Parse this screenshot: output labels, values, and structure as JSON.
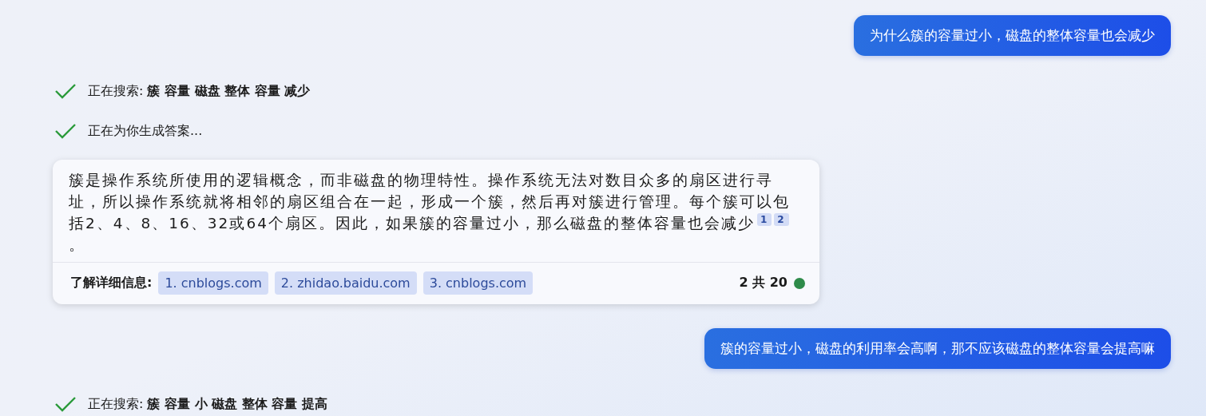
{
  "messages": [
    {
      "kind": "user",
      "text": "为什么簇的容量过小，磁盘的整体容量也会减少"
    },
    {
      "kind": "status",
      "done": true,
      "text": "正在搜索: **簇 容量 磁盘 整体 容量 减少**"
    },
    {
      "kind": "status",
      "done": true,
      "text": "正在为你生成答案..."
    },
    {
      "kind": "answer",
      "text": "簇是操作系统所使用的逻辑概念，而非磁盘的物理特性。操作系统无法对数目众多的扇区进行寻址，所以操作系统就将相邻的扇区组合在一起，形成一个簇，然后再对簇进行管理。每个簇可以包括2、4、8、16、32或64个扇区。因此，如果簇的容量过小，那么磁盘的整体容量也会减少",
      "citations": [
        "1",
        "2"
      ],
      "ending": "。",
      "learn_more_label": "了解详细信息:",
      "sources": [
        "1. cnblogs.com",
        "2. zhidao.baidu.com",
        "3. cnblogs.com"
      ],
      "counter": "2 共 20",
      "color": "#2e8b4a"
    },
    {
      "kind": "user",
      "text": "簇的容量过小，磁盘的利用率会高啊，那不应该磁盘的整体容量会提高嘛"
    },
    {
      "kind": "status",
      "done": true,
      "text": "正在搜索: **簇 容量 小 磁盘 整体 容量 提高**"
    }
  ]
}
